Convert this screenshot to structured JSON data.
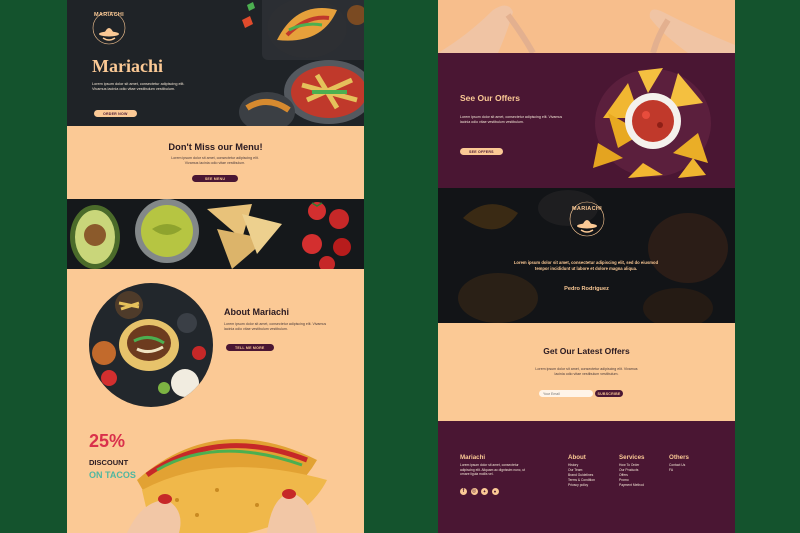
{
  "left": {
    "hero": {
      "logo_text": "MARIACHI",
      "title": "Mariachi",
      "text": "Lorem ipsum dolor sit amet, consectetur adipiscing elit. Vivamus lacinia odio vitae vestibulum vestibulum.",
      "button": "ORDER NOW"
    },
    "menu": {
      "heading": "Don't Miss our Menu!",
      "text": "Lorem ipsum dolor sit amet, consectetur adipiscing elit. Vivamus lacinia odio vitae vestibulum.",
      "button": "SEE MENU"
    },
    "about": {
      "heading": "About Mariachi",
      "text": "Lorem ipsum dolor sit amet, consectetur adipiscing elit. Vivamus lacinia odio vitae vestibulum vestibulum.",
      "button": "TELL ME MORE"
    },
    "promo": {
      "percent": "25%",
      "line1": "DISCOUNT",
      "line2": "ON TACOS"
    }
  },
  "right": {
    "offers": {
      "heading": "See Our Offers",
      "text": "Lorem ipsum dolor sit amet, consectetur adipiscing elit. Vivamus lacinia odio vitae vestibulum vestibulum.",
      "button": "SEE OFFERS"
    },
    "testimonial": {
      "logo_text": "MARIACHI",
      "quote": "Lorem ipsum dolor sit amet, consectetur adipiscing elit, sed do eiusmod tempor incididunt ut labore et dolore magna aliqua.",
      "author": "Pedro Rodriguez"
    },
    "newsletter": {
      "heading": "Get Our Latest Offers",
      "text": "Lorem ipsum dolor sit amet, consectetur adipiscing elit. Vivamus lacinia odio vitae vestibulum vestibulum.",
      "placeholder": "Your Email",
      "button": "SUBSCRIBE"
    },
    "footer": {
      "brand": "Mariachi",
      "brand_text": "Lorem ipsum dolor sit amet, consectetur adipiscing elit. Aliquam ac dignissim nunc, ut ornare ligula mollis vel.",
      "columns": [
        {
          "title": "About",
          "links": [
            "History",
            "Our Team",
            "Brand Guidelines",
            "Terms & Condition",
            "Privacy policy"
          ]
        },
        {
          "title": "Services",
          "links": [
            "How To Order",
            "Our Products",
            "Offers",
            "Promo",
            "Payment Method"
          ]
        },
        {
          "title": "Others",
          "links": [
            "Contact Us",
            "FA"
          ]
        }
      ],
      "social_icons": [
        "facebook-icon",
        "instagram-icon",
        "twitter-icon",
        "dribbble-icon"
      ]
    }
  },
  "colors": {
    "background": "#14532d",
    "peach": "#fbc995",
    "plum": "#4a1633",
    "dark": "#1c1e22",
    "promo_red": "#d9304b",
    "promo_teal": "#4fb7a0"
  }
}
